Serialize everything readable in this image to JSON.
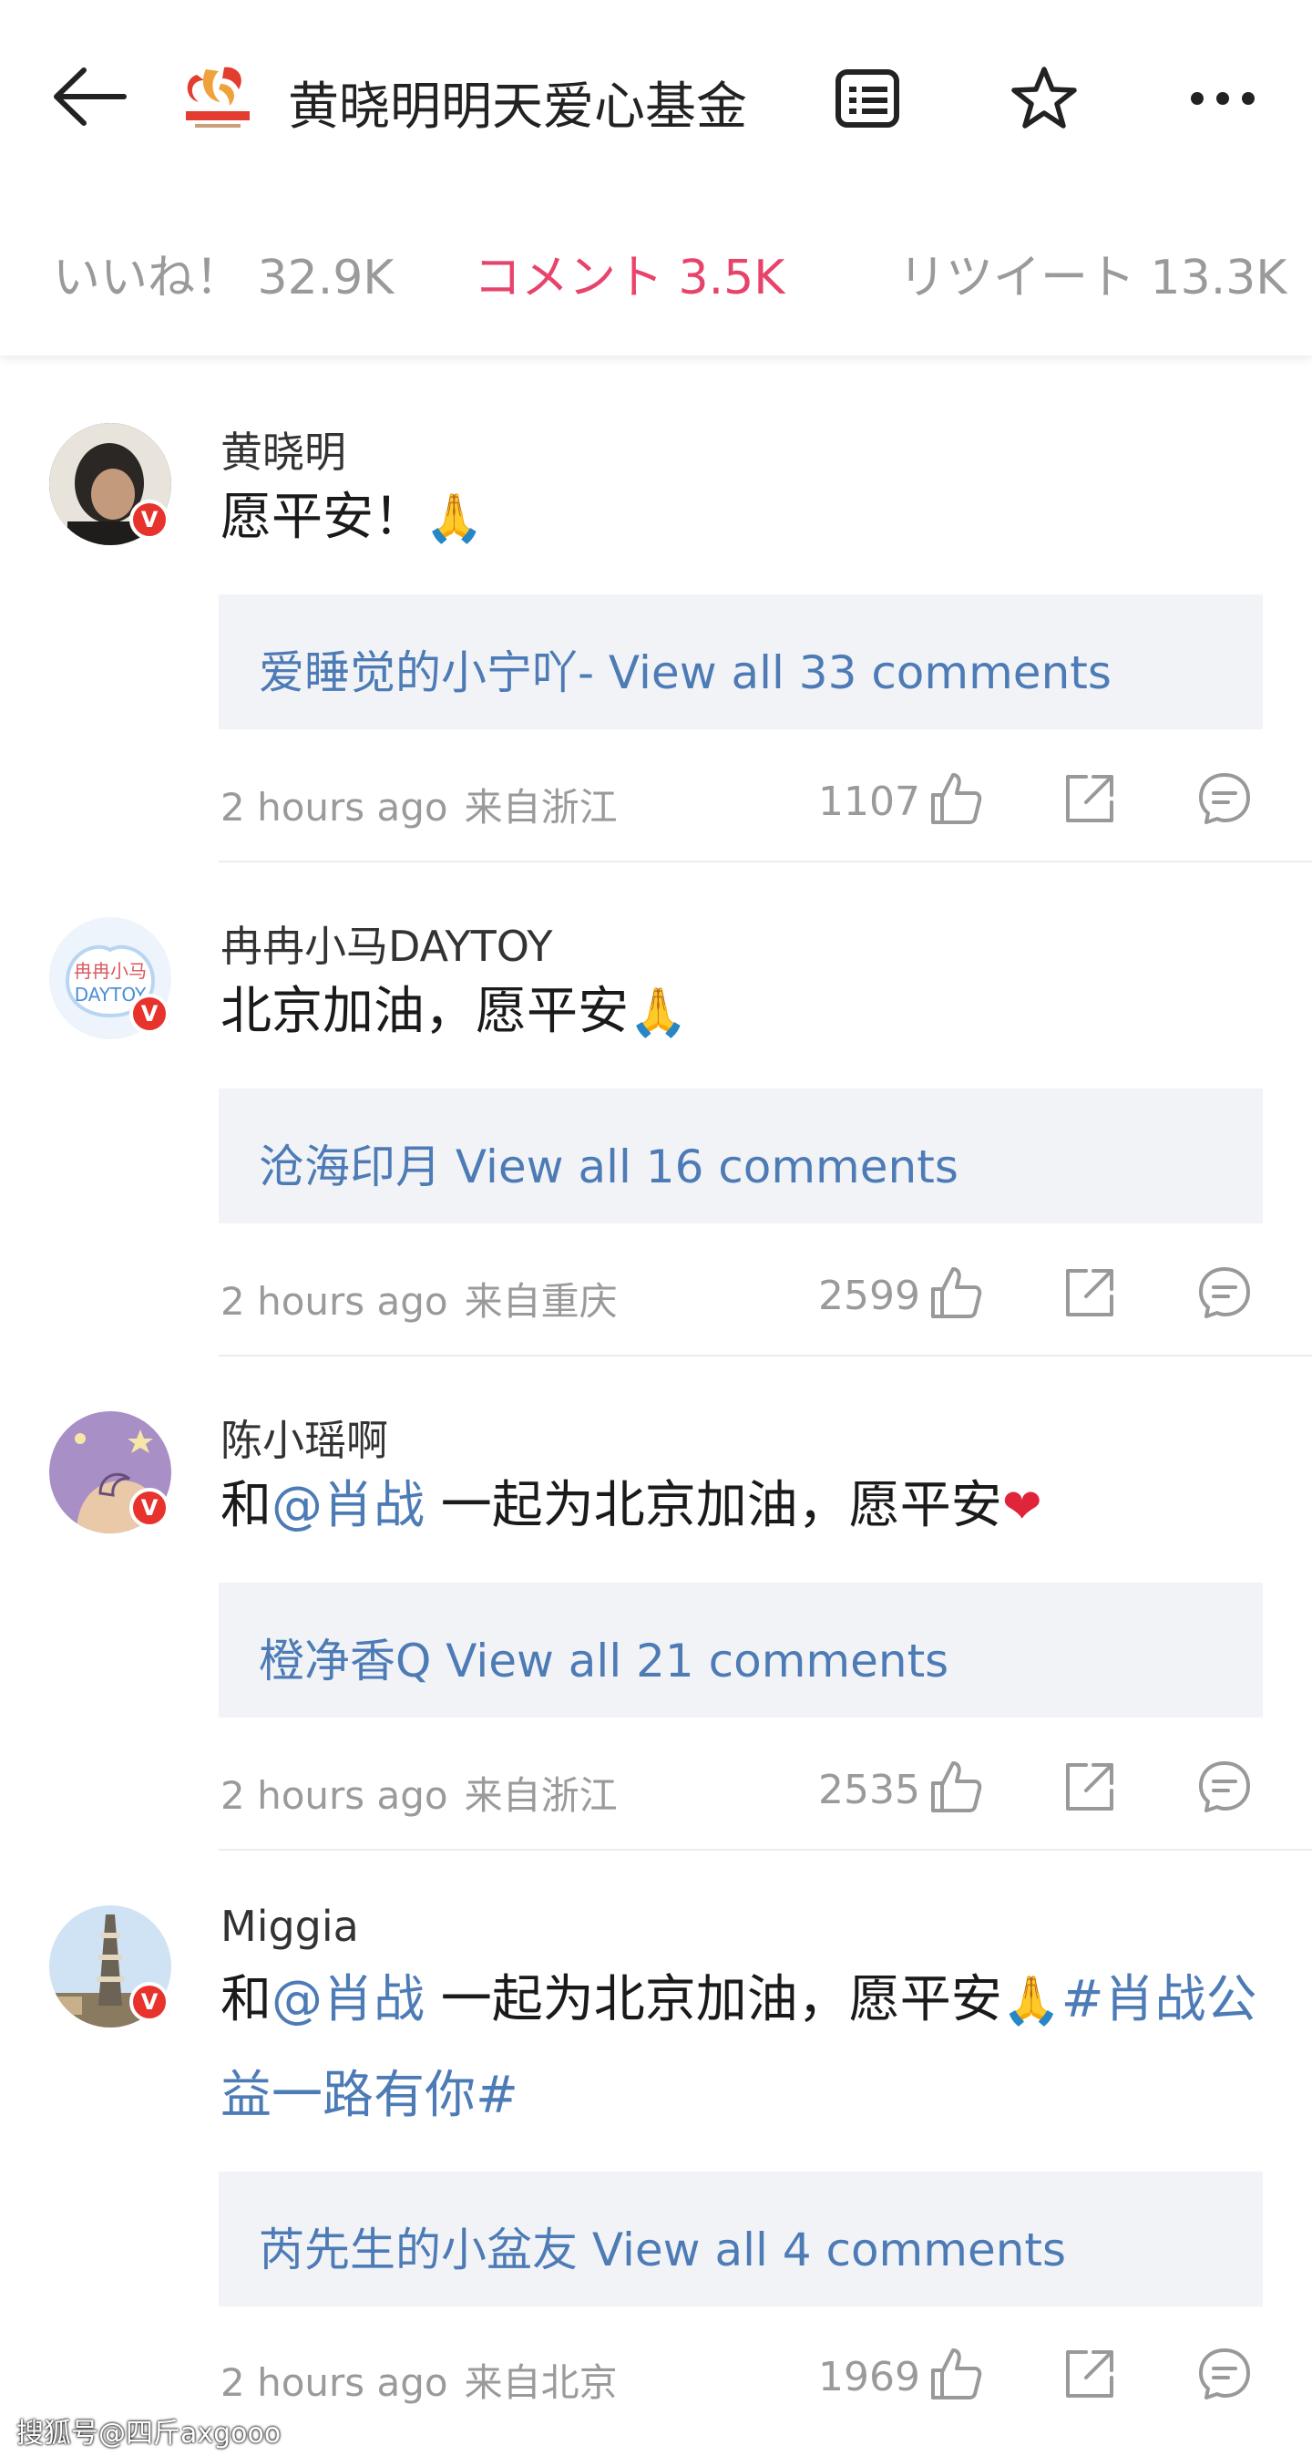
{
  "header": {
    "title": "黄晓明明天爱心基金",
    "icons": {
      "back": "back-arrow-icon",
      "list": "list-icon",
      "favorite": "star-icon",
      "more": "more-icon"
    }
  },
  "tabs": [
    {
      "label": "いいね！ 32.9K",
      "active": false
    },
    {
      "label": "コメント 3.5K",
      "active": true
    },
    {
      "label": "リツイート 13.3K",
      "active": false
    }
  ],
  "comments": [
    {
      "user": "黄晓明",
      "text": "愿平安！",
      "emoji": "🙏",
      "reply": "爱睡觉的小宁吖- View all 33 comments",
      "time": "2 hours ago",
      "location": "来自浙江",
      "likes": "1107"
    },
    {
      "user": "冉冉小马DAYTOY",
      "text": "北京加油，愿平安",
      "emoji": "🙏",
      "reply": "沧海印月 View all 16 comments",
      "time": "2 hours ago",
      "location": "来自重庆",
      "likes": "2599"
    },
    {
      "user": "陈小瑶啊",
      "text_prefix": "和",
      "mention": "@肖战",
      "text": " 一起为北京加油，愿平安",
      "emoji": "❤",
      "reply": "橙净香Q View all 21 comments",
      "time": "2 hours ago",
      "location": "来自浙江",
      "likes": "2535"
    },
    {
      "user": "Miggia",
      "text_prefix": "和",
      "mention": "@肖战",
      "text": " 一起为北京加油，愿平安",
      "emoji": "🙏",
      "hashtag": "#肖战公益一路有你#",
      "reply": "芮先生的小盆友 View all 4 comments",
      "time": "2 hours ago",
      "location": "来自北京",
      "likes": "1969"
    }
  ],
  "verified_badge": "V",
  "watermark": "搜狐号@四斤axgooo",
  "colors": {
    "accent": "#e8436a",
    "link": "#4d7bb6",
    "badge": "#e8322c",
    "reply_bg": "#f2f3f6"
  }
}
